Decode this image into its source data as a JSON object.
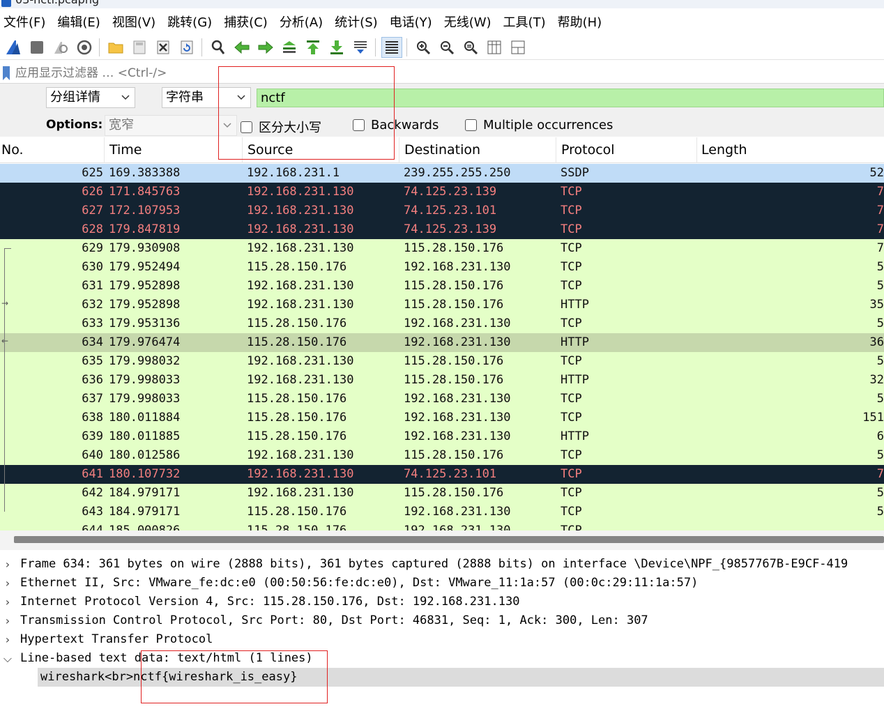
{
  "window": {
    "title": "03-nctf.pcapng"
  },
  "menu": [
    "文件(F)",
    "编辑(E)",
    "视图(V)",
    "跳转(G)",
    "捕获(C)",
    "分析(A)",
    "统计(S)",
    "电话(Y)",
    "无线(W)",
    "工具(T)",
    "帮助(H)"
  ],
  "toolbar": {
    "icons": [
      "start-capture-icon",
      "stop-capture-icon",
      "restart-capture-icon",
      "capture-options-icon",
      "open-file-icon",
      "save-file-icon",
      "close-file-icon",
      "reload-file-icon",
      "find-packet-icon",
      "go-back-icon",
      "go-forward-icon",
      "go-to-packet-icon",
      "first-packet-icon",
      "last-packet-icon",
      "auto-scroll-icon",
      "colorize-icon",
      "zoom-in-icon",
      "zoom-out-icon",
      "normal-size-icon",
      "resize-columns-icon",
      "layout-icon"
    ]
  },
  "filter": {
    "placeholder": "应用显示过滤器 … <Ctrl-/>"
  },
  "find": {
    "search_in": "分组详情",
    "search_type": "字符串",
    "value": "nctf",
    "options_label": "Options:",
    "charset": "宽窄",
    "case_sensitive": "区分大小写",
    "backwards": "Backwards",
    "multiple": "Multiple occurrences"
  },
  "columns": [
    "No.",
    "Time",
    "Source",
    "Destination",
    "Protocol",
    "Length"
  ],
  "packets": [
    {
      "no": "625",
      "time": "169.383388",
      "src": "192.168.231.1",
      "dst": "239.255.255.250",
      "proto": "SSDP",
      "len": "52",
      "style": "ssdp"
    },
    {
      "no": "626",
      "time": "171.845763",
      "src": "192.168.231.130",
      "dst": "74.125.23.139",
      "proto": "TCP",
      "len": "7",
      "style": "dark"
    },
    {
      "no": "627",
      "time": "172.107953",
      "src": "192.168.231.130",
      "dst": "74.125.23.101",
      "proto": "TCP",
      "len": "7",
      "style": "dark"
    },
    {
      "no": "628",
      "time": "179.847819",
      "src": "192.168.231.130",
      "dst": "74.125.23.139",
      "proto": "TCP",
      "len": "7",
      "style": "dark"
    },
    {
      "no": "629",
      "time": "179.930908",
      "src": "192.168.231.130",
      "dst": "115.28.150.176",
      "proto": "TCP",
      "len": "7",
      "style": "green"
    },
    {
      "no": "630",
      "time": "179.952494",
      "src": "115.28.150.176",
      "dst": "192.168.231.130",
      "proto": "TCP",
      "len": "5",
      "style": "green"
    },
    {
      "no": "631",
      "time": "179.952898",
      "src": "192.168.231.130",
      "dst": "115.28.150.176",
      "proto": "TCP",
      "len": "5",
      "style": "green"
    },
    {
      "no": "632",
      "time": "179.952898",
      "src": "192.168.231.130",
      "dst": "115.28.150.176",
      "proto": "HTTP",
      "len": "35",
      "style": "green"
    },
    {
      "no": "633",
      "time": "179.953136",
      "src": "115.28.150.176",
      "dst": "192.168.231.130",
      "proto": "TCP",
      "len": "5",
      "style": "green"
    },
    {
      "no": "634",
      "time": "179.976474",
      "src": "115.28.150.176",
      "dst": "192.168.231.130",
      "proto": "HTTP",
      "len": "36",
      "style": "selected"
    },
    {
      "no": "635",
      "time": "179.998032",
      "src": "192.168.231.130",
      "dst": "115.28.150.176",
      "proto": "TCP",
      "len": "5",
      "style": "green"
    },
    {
      "no": "636",
      "time": "179.998033",
      "src": "192.168.231.130",
      "dst": "115.28.150.176",
      "proto": "HTTP",
      "len": "32",
      "style": "green"
    },
    {
      "no": "637",
      "time": "179.998033",
      "src": "115.28.150.176",
      "dst": "192.168.231.130",
      "proto": "TCP",
      "len": "5",
      "style": "green"
    },
    {
      "no": "638",
      "time": "180.011884",
      "src": "115.28.150.176",
      "dst": "192.168.231.130",
      "proto": "TCP",
      "len": "151",
      "style": "green"
    },
    {
      "no": "639",
      "time": "180.011885",
      "src": "115.28.150.176",
      "dst": "192.168.231.130",
      "proto": "HTTP",
      "len": "6",
      "style": "green"
    },
    {
      "no": "640",
      "time": "180.012586",
      "src": "192.168.231.130",
      "dst": "115.28.150.176",
      "proto": "TCP",
      "len": "5",
      "style": "green"
    },
    {
      "no": "641",
      "time": "180.107732",
      "src": "192.168.231.130",
      "dst": "74.125.23.101",
      "proto": "TCP",
      "len": "7",
      "style": "dark"
    },
    {
      "no": "642",
      "time": "184.979171",
      "src": "192.168.231.130",
      "dst": "115.28.150.176",
      "proto": "TCP",
      "len": "5",
      "style": "green"
    },
    {
      "no": "643",
      "time": "184.979171",
      "src": "115.28.150.176",
      "dst": "192.168.231.130",
      "proto": "TCP",
      "len": "5",
      "style": "green"
    },
    {
      "no": "644",
      "time": "185.000826",
      "src": "115.28.150.176",
      "dst": "192.168.231.130",
      "proto": "TCP",
      "len": "",
      "style": "green"
    }
  ],
  "details": [
    {
      "text": "Frame 634: 361 bytes on wire (2888 bits), 361 bytes captured (2888 bits) on interface \\Device\\NPF_{9857767B-E9CF-419",
      "expanded": false
    },
    {
      "text": "Ethernet II, Src: VMware_fe:dc:e0 (00:50:56:fe:dc:e0), Dst: VMware_11:1a:57 (00:0c:29:11:1a:57)",
      "expanded": false
    },
    {
      "text": "Internet Protocol Version 4, Src: 115.28.150.176, Dst: 192.168.231.130",
      "expanded": false
    },
    {
      "text": "Transmission Control Protocol, Src Port: 80, Dst Port: 46831, Seq: 1, Ack: 300, Len: 307",
      "expanded": false
    },
    {
      "text": "Hypertext Transfer Protocol",
      "expanded": false
    },
    {
      "text": "Line-based text data: text/html (1 lines)",
      "expanded": true
    }
  ],
  "detail_child": "wireshark<br>nctf{wireshark_is_easy}",
  "colors": {
    "ssdp_bg": "#c0dcf7",
    "dark_bg": "#132331",
    "dark_fg": "#f47f7f",
    "http_tcp_bg": "#e4ffc7",
    "selected_bg": "#c6d8ac",
    "find_match_bg": "#b8f0a8",
    "annotation_red": "#e02020"
  }
}
